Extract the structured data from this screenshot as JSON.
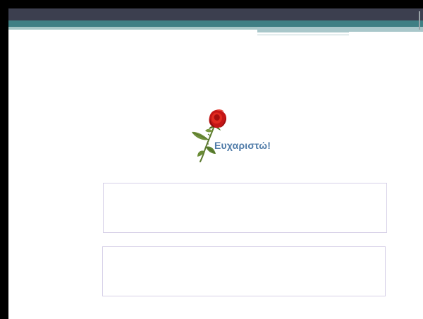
{
  "slide": {
    "message": "Ευχαριστώ!",
    "image": "red-rose",
    "colors": {
      "header_dark": "#3c3f4f",
      "header_teal": "#3f7f84",
      "header_light": "#a6c6c6",
      "message_text": "#4f7ba8",
      "box_border": "#d7d1e8"
    }
  },
  "text_boxes": [
    {
      "text": ""
    },
    {
      "text": ""
    }
  ]
}
